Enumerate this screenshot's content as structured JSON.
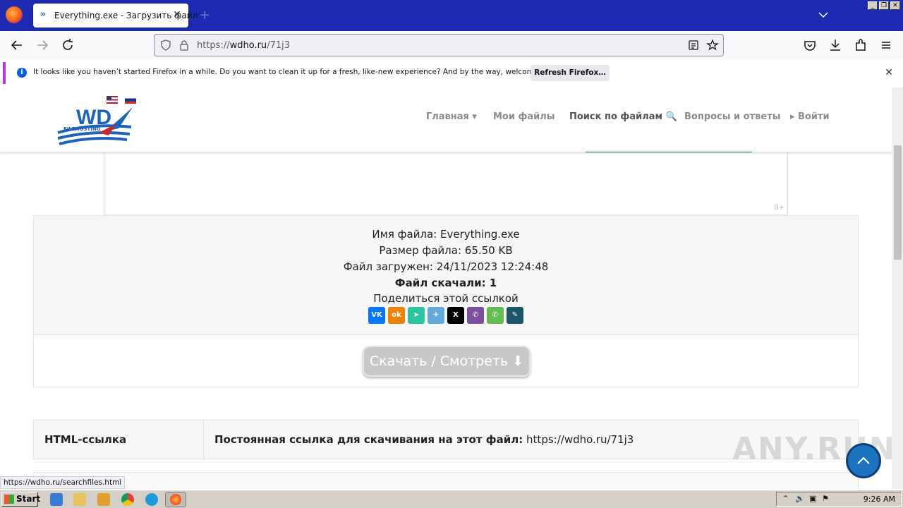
{
  "browser": {
    "tab": {
      "title": "Everything.exe - Загрузить файл"
    },
    "url": {
      "scheme": "https://",
      "host": "wdho.ru",
      "path": "/71j3"
    },
    "notification": {
      "message": "It looks like you haven’t started Firefox in a while. Do you want to clean it up for a fresh, like-new experience? And by the way, welcome back!",
      "button": "Refresh Firefox…"
    },
    "status_url": "https://wdho.ru/searchfiles.html"
  },
  "site": {
    "logo_text": "WD",
    "logo_sub": "FILEHOSTING",
    "nav": {
      "home": "Главная ▾",
      "my_files": "Мои файлы",
      "search": "Поиск по файлам 🔍",
      "faq": "Вопросы и ответы",
      "login": "▸ Войти"
    },
    "ad_label": "0+",
    "file": {
      "name_line": "Имя файла: Everything.exe",
      "size_line": "Размер файла: 65.50 KB",
      "uploaded_line": "Файл загружен: 24/11/2023 12:24:48",
      "downloads_line": "Файл скачали: 1",
      "share_label": "Поделиться этой ссылкой"
    },
    "share_buttons": [
      {
        "name": "vk",
        "glyph": "VK",
        "color": "#0077ff"
      },
      {
        "name": "odnoklassniki",
        "glyph": "ok",
        "color": "#ee8208"
      },
      {
        "name": "yandex-messenger",
        "glyph": "➤",
        "color": "#2bc6a0"
      },
      {
        "name": "telegram",
        "glyph": "✈",
        "color": "#64a9dc"
      },
      {
        "name": "x",
        "glyph": "X",
        "color": "#000000"
      },
      {
        "name": "viber",
        "glyph": "✆",
        "color": "#7b519d"
      },
      {
        "name": "whatsapp",
        "glyph": "✆",
        "color": "#65bc54"
      },
      {
        "name": "livejournal",
        "glyph": "✎",
        "color": "#1d5467"
      }
    ],
    "download_button": "Скачать / Смотреть ⬇",
    "link_table": {
      "label": "HTML-ссылка",
      "value_bold": "Постоянная ссылка для скачивания на этот файл:",
      "value_link": "https://wdho.ru/71j3"
    },
    "watermark": "ANY.RUN"
  },
  "taskbar": {
    "start": "Start",
    "clock": "9:26 AM"
  }
}
